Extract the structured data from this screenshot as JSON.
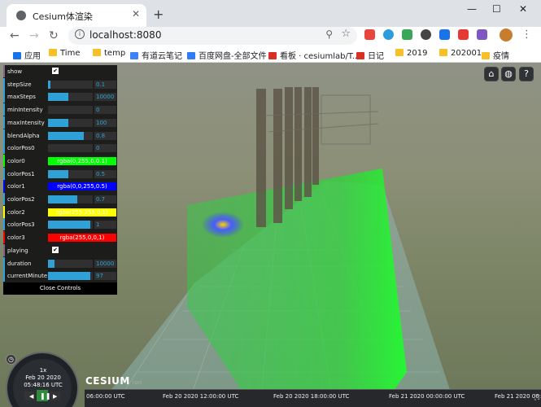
{
  "browser": {
    "tab_title": "Cesium体渲染",
    "tab_close": "✕",
    "new_tab": "+",
    "url": "localhost:8080",
    "window_controls": [
      "—",
      "☐",
      "✕"
    ]
  },
  "bookmarks": [
    {
      "label": "应用",
      "icon": "apps-icon",
      "color": "#1a73e8"
    },
    {
      "label": "Time",
      "icon": "folder-icon",
      "color": "#f6c026"
    },
    {
      "label": "temp",
      "icon": "folder-icon",
      "color": "#f6c026"
    },
    {
      "label": "有道云笔记",
      "icon": "youdao-icon",
      "color": "#3b83f6"
    },
    {
      "label": "百度网盘-全部文件",
      "icon": "baidu-icon",
      "color": "#2f7cf6"
    },
    {
      "label": "看板 · cesiumlab/T...",
      "icon": "github-icon",
      "color": "#d93025"
    },
    {
      "label": "日记",
      "icon": "github-icon",
      "color": "#d93025"
    },
    {
      "label": "2019",
      "icon": "folder-icon",
      "color": "#f6c026"
    },
    {
      "label": "202001",
      "icon": "folder-icon",
      "color": "#f6c026"
    },
    {
      "label": "疫情",
      "icon": "folder-icon",
      "color": "#f6c026"
    }
  ],
  "controls": {
    "rows": [
      {
        "label": "show",
        "type": "checkbox",
        "checked": true
      },
      {
        "label": "stepSize",
        "type": "slider",
        "fill": 0.05,
        "value": "0.1"
      },
      {
        "label": "maxSteps",
        "type": "slider",
        "fill": 0.45,
        "value": "10000"
      },
      {
        "label": "minIntensity",
        "type": "slider",
        "fill": 0.0,
        "value": "0"
      },
      {
        "label": "maxIntensity",
        "type": "slider",
        "fill": 0.45,
        "value": "100"
      },
      {
        "label": "blendAlpha",
        "type": "slider",
        "fill": 0.8,
        "value": "0.8"
      },
      {
        "label": "colorPos0",
        "type": "slider",
        "fill": 0.0,
        "value": "0"
      },
      {
        "label": "color0",
        "type": "color",
        "value": "rgba(0,255,0,0.1)",
        "bg": "#00ff00",
        "fg": "#ffffff"
      },
      {
        "label": "colorPos1",
        "type": "slider",
        "fill": 0.45,
        "value": "0.5"
      },
      {
        "label": "color1",
        "type": "color",
        "value": "rgba(0,0,255,0.5)",
        "bg": "#0000ff",
        "fg": "#ffffff"
      },
      {
        "label": "colorPos2",
        "type": "slider",
        "fill": 0.65,
        "value": "0.7"
      },
      {
        "label": "color2",
        "type": "color",
        "value": "rgba(255,255,0,1)",
        "bg": "#ffff00",
        "fg": "#ffffff"
      },
      {
        "label": "colorPos3",
        "type": "slider",
        "fill": 0.95,
        "value": "1"
      },
      {
        "label": "color3",
        "type": "color",
        "value": "rgba(255,0,0,1)",
        "bg": "#ff0000",
        "fg": "#ffffff"
      },
      {
        "label": "playing",
        "type": "checkbox",
        "checked": true
      },
      {
        "label": "duration",
        "type": "slider",
        "fill": 0.15,
        "value": "10000"
      },
      {
        "label": "currentMinute",
        "type": "slider",
        "fill": 0.95,
        "value": "97"
      }
    ],
    "close_label": "Close Controls"
  },
  "toolbar_icons": [
    "home-icon",
    "globe-icon",
    "help-icon"
  ],
  "clock": {
    "speed": "1x",
    "date": "Feb 20 2020",
    "time": "05:48:16 UTC"
  },
  "logo": {
    "text": "CESIUM",
    "sub": "ion"
  },
  "timeline": {
    "ticks": [
      "06:00:00 UTC",
      "Feb 20 2020 12:00:00 UTC",
      "Feb 20 2020 18:00:00 UTC",
      "Feb 21 2020 00:00:00 UTC",
      "Feb 21 2020 06:00:00 UTC"
    ]
  }
}
